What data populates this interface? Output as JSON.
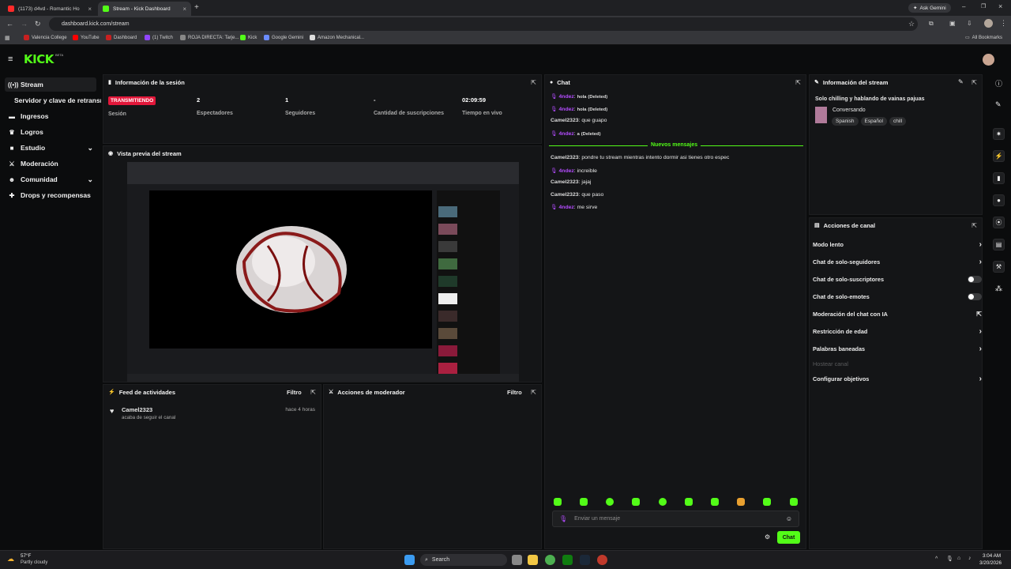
{
  "browser": {
    "tabs": [
      {
        "title": "(1173) d4vd - Romantic Ho"
      },
      {
        "title": "Stream - Kick Dashboard"
      }
    ],
    "ask_gemini": "Ask Gemini",
    "url": "dashboard.kick.com/stream",
    "bookmarks": [
      "Valencia College",
      "YouTube",
      "Dashboard",
      "(1) Twitch",
      "ROJA DIRECTA: Tarje...",
      "Kick",
      "Google Gemini",
      "Amazon Mechanical..."
    ],
    "all_bookmarks": "All Bookmarks"
  },
  "app": {
    "logo": "KICK",
    "logo_badge": "BETA"
  },
  "sidebar": {
    "items": [
      {
        "label": "Stream",
        "icon": "broadcast-icon"
      },
      {
        "label": "Servidor y clave de retransmisión"
      },
      {
        "label": "Ingresos",
        "icon": "money-icon"
      },
      {
        "label": "Logros",
        "icon": "trophy-icon"
      },
      {
        "label": "Estudio",
        "icon": "video-icon"
      },
      {
        "label": "Moderación",
        "icon": "sword-icon"
      },
      {
        "label": "Comunidad",
        "icon": "people-icon"
      },
      {
        "label": "Drops y recompensas",
        "icon": "gift-icon"
      }
    ]
  },
  "session": {
    "title": "Información de la sesión",
    "status": "TRANSMITIENDO",
    "status_label": "Sesión",
    "viewers": "2",
    "viewers_label": "Espectadores",
    "followers": "1",
    "followers_label": "Seguidores",
    "subs": "-",
    "subs_label": "Cantidad de suscripciones",
    "live_time": "02:09:59",
    "live_time_label": "Tiempo en vivo"
  },
  "preview": {
    "title": "Vista previa del stream"
  },
  "activity": {
    "title": "Feed de actividades",
    "filter": "Filtro",
    "user": "Camel2323",
    "time": "hace 4 horas",
    "text": "acaba de seguir el canal"
  },
  "modactions": {
    "title": "Acciones de moderador",
    "filter": "Filtro"
  },
  "chat": {
    "title": "Chat",
    "messages": [
      {
        "user": "4ndez",
        "text": "hola",
        "note": "(Deleted)"
      },
      {
        "user": "4ndez",
        "text": "hola",
        "note": "(Deleted)"
      },
      {
        "user": "Camel2323",
        "text": "que guapo"
      },
      {
        "user": "4ndez",
        "text": "a",
        "note": "(Deleted)"
      }
    ],
    "new_messages": "Nuevos mensajes",
    "messages2": [
      {
        "user": "Camel2323",
        "text": "pondre tu stream mientras intento dormir asi tienes otro espec"
      },
      {
        "user": "4ndez",
        "text": "increible"
      },
      {
        "user": "Camel2323",
        "text": "jajaj"
      },
      {
        "user": "Camel2323",
        "text": "que paso"
      },
      {
        "user": "4ndez",
        "text": "me sirve"
      }
    ],
    "placeholder": "Enviar un mensaje",
    "send": "Chat"
  },
  "streaminfo": {
    "title": "Información del stream",
    "stream_title": "Solo chilling y hablando de vainas pajuas",
    "category": "Conversando",
    "tags": [
      "Spanish",
      "Español",
      "chill"
    ]
  },
  "channel": {
    "title": "Acciones de canal",
    "rows": [
      {
        "label": "Modo lento",
        "control": "arrow"
      },
      {
        "label": "Chat de solo-seguidores",
        "control": "arrow"
      },
      {
        "label": "Chat de solo-suscriptores",
        "control": "toggle"
      },
      {
        "label": "Chat de solo-emotes",
        "control": "toggle"
      },
      {
        "label": "Moderación del chat con IA",
        "control": "popout"
      },
      {
        "label": "Restricción de edad",
        "control": "arrow"
      },
      {
        "label": "Palabras baneadas",
        "control": "arrow"
      },
      {
        "label": "Hostear canal",
        "control": "disabled"
      },
      {
        "label": "Configurar objetivos",
        "control": "arrow"
      }
    ]
  },
  "taskbar": {
    "temp": "57°F",
    "weather": "Partly cloudy",
    "search": "Search",
    "time": "3:04 AM",
    "date": "3/20/2026"
  },
  "colors": {
    "accent": "#53fc18",
    "live": "#e2173a",
    "username": "#b44cff"
  }
}
